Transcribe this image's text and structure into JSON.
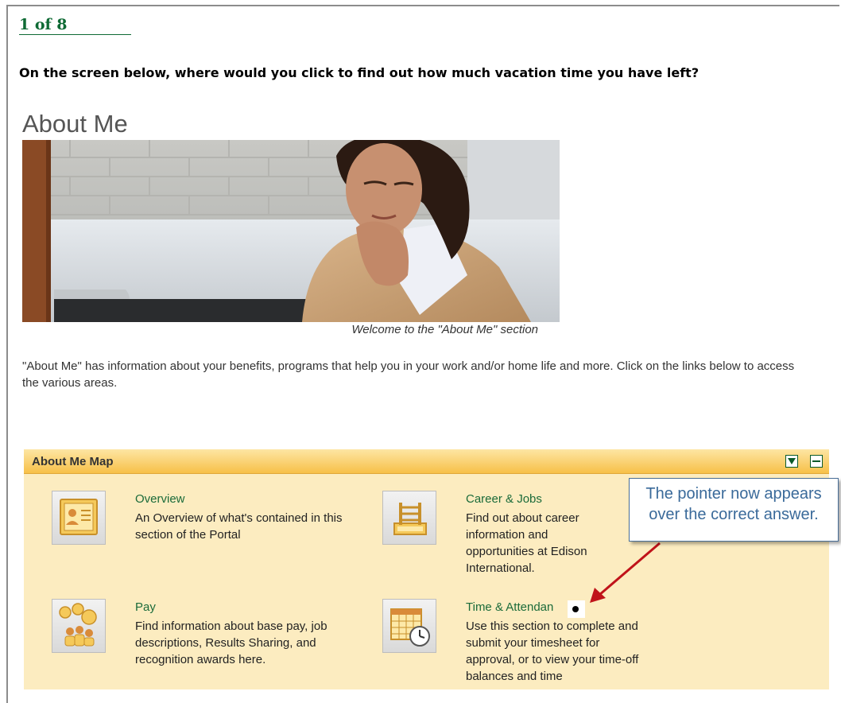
{
  "quiz": {
    "counter": "1 of 8",
    "question": "On the screen below, where would you click to find out how much vacation time you have left?"
  },
  "page": {
    "title": "About Me",
    "image_caption": "Welcome to the \"About Me\" section",
    "intro": "\"About Me\"  has information about your benefits, programs that help you in your work and/or home life and more. Click on the links below to access the various areas."
  },
  "map": {
    "title": "About Me Map",
    "items": [
      {
        "title": "Overview",
        "icon": "profile-card-icon",
        "description": "An Overview of what's contained in this section of the Portal"
      },
      {
        "title": "Career & Jobs",
        "icon": "career-ladder-icon",
        "description": "Find out about career information and opportunities at Edison International."
      },
      {
        "title": "Pay",
        "icon": "people-coins-icon",
        "description": "Find information about base pay, job descriptions, Results Sharing, and recognition awards here."
      },
      {
        "title": "Time & Attendan",
        "icon": "calendar-clock-icon",
        "description": "Use this section to complete and submit your timesheet for approval, or to view your time-off balances and time"
      }
    ]
  },
  "callout": {
    "text": "The pointer now appears over the correct answer."
  },
  "colors": {
    "accent_green": "#0e6a34",
    "panel_bg": "#fcecc0",
    "callout_border": "#4a6f97",
    "arrow": "#c0131a"
  }
}
